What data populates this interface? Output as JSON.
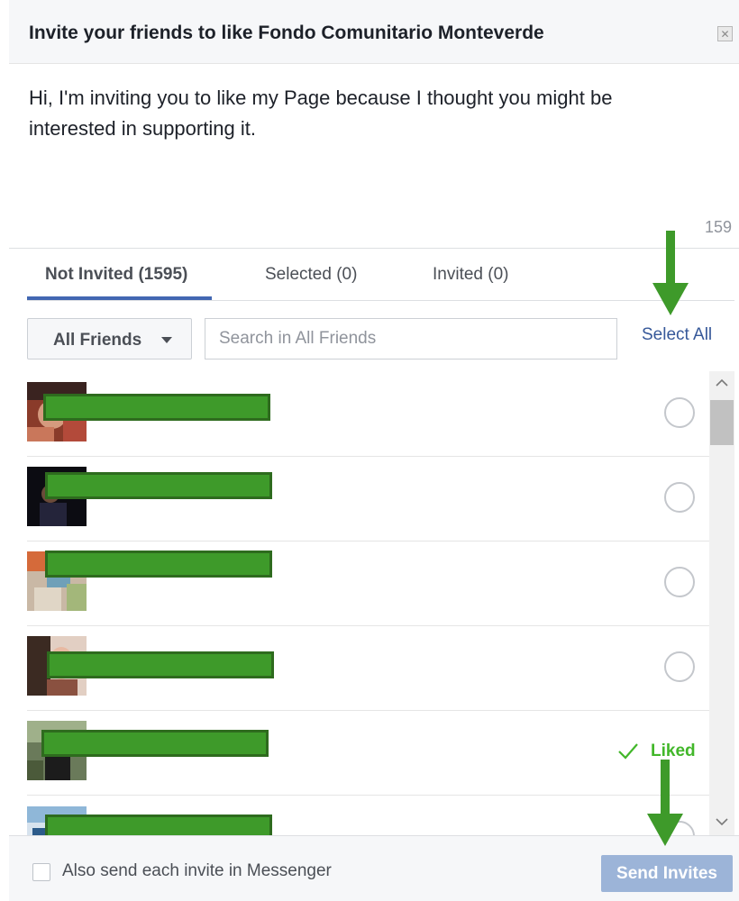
{
  "dialog": {
    "title": "Invite your friends to like Fondo Comunitario Monteverde",
    "close_icon": "close-icon"
  },
  "message": {
    "text": "Hi, I'm inviting you to like my Page because I thought you might be interested in supporting it.",
    "char_count": "159"
  },
  "tabs": [
    {
      "label": "Not Invited (1595)",
      "active": true
    },
    {
      "label": "Selected (0)",
      "active": false
    },
    {
      "label": "Invited (0)",
      "active": false
    }
  ],
  "filter": {
    "dropdown_value": "All Friends",
    "search_placeholder": "Search in All Friends",
    "select_all_label": "Select All"
  },
  "friends": [
    {
      "status": "not-selected"
    },
    {
      "status": "not-selected"
    },
    {
      "status": "not-selected"
    },
    {
      "status": "not-selected"
    },
    {
      "status": "liked",
      "status_label": "Liked"
    },
    {
      "status": "not-selected"
    }
  ],
  "footer": {
    "messenger_checkbox_label": "Also send each invite in Messenger",
    "messenger_checked": false,
    "send_button_label": "Send Invites"
  },
  "colors": {
    "accent": "#4267b2",
    "link": "#365899",
    "liked": "#42b72a",
    "annotation_arrow": "#3e9a2a",
    "send_disabled": "#9cb4d8"
  }
}
